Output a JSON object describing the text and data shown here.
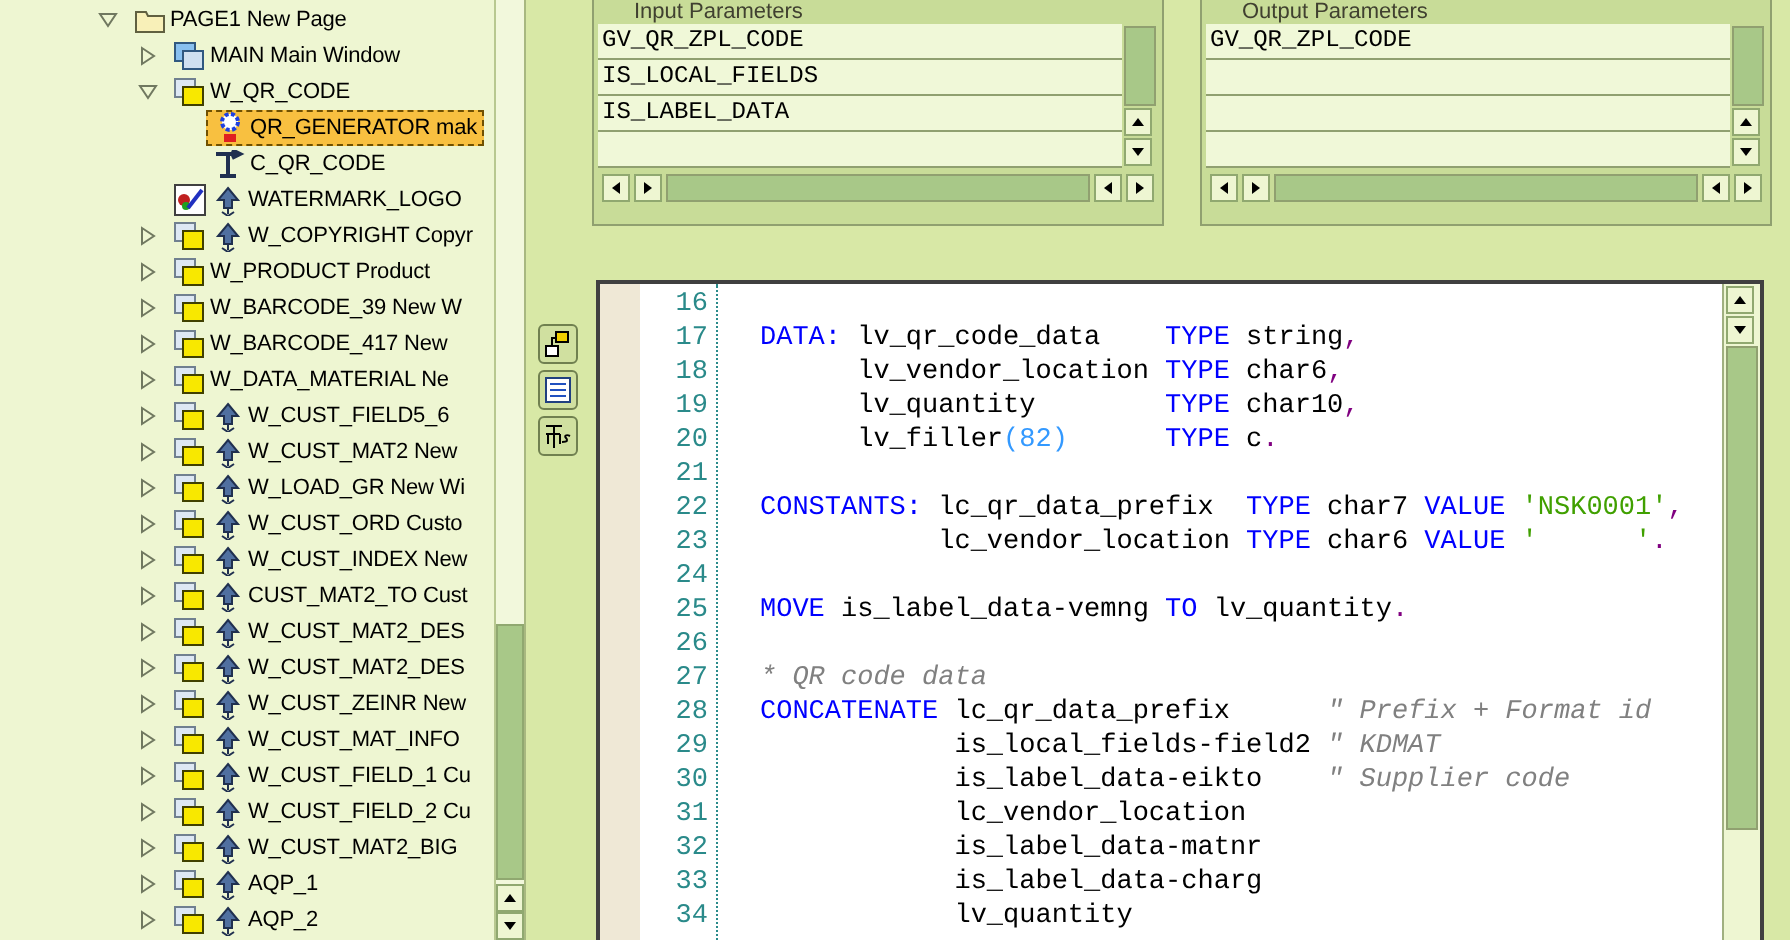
{
  "tree": {
    "items": [
      {
        "label": "PAGE1 New Page",
        "kind": "page",
        "flagged": false,
        "selected": false,
        "expanded": true,
        "children": [
          {
            "label": "MAIN Main Window",
            "kind": "main-window",
            "flagged": false,
            "selected": false,
            "expanded": false
          },
          {
            "label": "W_QR_CODE",
            "kind": "window",
            "flagged": false,
            "selected": false,
            "expanded": true,
            "children": [
              {
                "label": "QR_GENERATOR mak",
                "kind": "program",
                "flagged": false,
                "selected": true
              },
              {
                "label": "C_QR_CODE",
                "kind": "command",
                "flagged": false,
                "selected": false
              }
            ]
          },
          {
            "label": "WATERMARK_LOGO",
            "kind": "graphic",
            "flagged": true,
            "selected": false
          },
          {
            "label": "W_COPYRIGHT Copyr",
            "kind": "window",
            "flagged": true,
            "selected": false,
            "expanded": false
          },
          {
            "label": "W_PRODUCT Product",
            "kind": "window",
            "flagged": false,
            "selected": false,
            "expanded": false
          },
          {
            "label": "W_BARCODE_39 New W",
            "kind": "window",
            "flagged": false,
            "selected": false,
            "expanded": false
          },
          {
            "label": "W_BARCODE_417 New",
            "kind": "window",
            "flagged": false,
            "selected": false,
            "expanded": false
          },
          {
            "label": "W_DATA_MATERIAL Ne",
            "kind": "window",
            "flagged": false,
            "selected": false,
            "expanded": false
          },
          {
            "label": "W_CUST_FIELD5_6",
            "kind": "window",
            "flagged": true,
            "selected": false,
            "expanded": false
          },
          {
            "label": "W_CUST_MAT2 New",
            "kind": "window",
            "flagged": true,
            "selected": false,
            "expanded": false
          },
          {
            "label": "W_LOAD_GR New Wi",
            "kind": "window",
            "flagged": true,
            "selected": false,
            "expanded": false
          },
          {
            "label": "W_CUST_ORD Custo",
            "kind": "window",
            "flagged": true,
            "selected": false,
            "expanded": false
          },
          {
            "label": "W_CUST_INDEX New",
            "kind": "window",
            "flagged": true,
            "selected": false,
            "expanded": false
          },
          {
            "label": "CUST_MAT2_TO Cust",
            "kind": "window",
            "flagged": true,
            "selected": false,
            "expanded": false
          },
          {
            "label": "W_CUST_MAT2_DES",
            "kind": "window",
            "flagged": true,
            "selected": false,
            "expanded": false
          },
          {
            "label": "W_CUST_MAT2_DES",
            "kind": "window",
            "flagged": true,
            "selected": false,
            "expanded": false
          },
          {
            "label": "W_CUST_ZEINR New",
            "kind": "window",
            "flagged": true,
            "selected": false,
            "expanded": false
          },
          {
            "label": "W_CUST_MAT_INFO",
            "kind": "window",
            "flagged": true,
            "selected": false,
            "expanded": false
          },
          {
            "label": "W_CUST_FIELD_1 Cu",
            "kind": "window",
            "flagged": true,
            "selected": false,
            "expanded": false
          },
          {
            "label": "W_CUST_FIELD_2 Cu",
            "kind": "window",
            "flagged": true,
            "selected": false,
            "expanded": false
          },
          {
            "label": "W_CUST_MAT2_BIG",
            "kind": "window",
            "flagged": true,
            "selected": false,
            "expanded": false
          },
          {
            "label": "AQP_1",
            "kind": "window",
            "flagged": true,
            "selected": false,
            "expanded": false
          },
          {
            "label": "AQP_2",
            "kind": "window",
            "flagged": true,
            "selected": false,
            "expanded": false
          }
        ]
      }
    ]
  },
  "input_parameters": {
    "title": "Input Parameters",
    "rows": [
      "GV_QR_ZPL_CODE",
      "IS_LOCAL_FIELDS",
      "IS_LABEL_DATA"
    ]
  },
  "output_parameters": {
    "title": "Output Parameters",
    "rows": [
      "GV_QR_ZPL_CODE"
    ]
  },
  "editor": {
    "lines": [
      {
        "number": "16"
      },
      {
        "number": "17",
        "tokens": [
          {
            "kind": "keyword",
            "text": "DATA:"
          },
          {
            "kind": "ident",
            "text": " lv_qr_code_data    "
          },
          {
            "kind": "keyword",
            "text": "TYPE"
          },
          {
            "kind": "ident",
            "text": " string"
          },
          {
            "kind": "punct",
            "text": ","
          }
        ]
      },
      {
        "number": "18",
        "tokens": [
          {
            "kind": "ident",
            "text": "      lv_vendor_location "
          },
          {
            "kind": "keyword",
            "text": "TYPE"
          },
          {
            "kind": "ident",
            "text": " char6"
          },
          {
            "kind": "punct",
            "text": ","
          }
        ]
      },
      {
        "number": "19",
        "tokens": [
          {
            "kind": "ident",
            "text": "      lv_quantity        "
          },
          {
            "kind": "keyword",
            "text": "TYPE"
          },
          {
            "kind": "ident",
            "text": " char10"
          },
          {
            "kind": "punct",
            "text": ","
          }
        ]
      },
      {
        "number": "20",
        "tokens": [
          {
            "kind": "ident",
            "text": "      lv_filler"
          },
          {
            "kind": "number",
            "text": "(82)"
          },
          {
            "kind": "keyword",
            "text": "      TYPE"
          },
          {
            "kind": "ident",
            "text": " c"
          },
          {
            "kind": "punct",
            "text": "."
          }
        ]
      },
      {
        "number": "21"
      },
      {
        "number": "22",
        "tokens": [
          {
            "kind": "keyword",
            "text": "CONSTANTS:"
          },
          {
            "kind": "ident",
            "text": " lc_qr_data_prefix  "
          },
          {
            "kind": "keyword",
            "text": "TYPE"
          },
          {
            "kind": "ident",
            "text": " char7 "
          },
          {
            "kind": "keyword",
            "text": "VALUE"
          },
          {
            "kind": "string",
            "text": " 'NSK0001'"
          },
          {
            "kind": "punct",
            "text": ","
          }
        ]
      },
      {
        "number": "23",
        "tokens": [
          {
            "kind": "ident",
            "text": "           lc_vendor_location "
          },
          {
            "kind": "keyword",
            "text": "TYPE"
          },
          {
            "kind": "ident",
            "text": " char6 "
          },
          {
            "kind": "keyword",
            "text": "VALUE"
          },
          {
            "kind": "string",
            "text": " '      '"
          },
          {
            "kind": "punct",
            "text": "."
          }
        ]
      },
      {
        "number": "24"
      },
      {
        "number": "25",
        "tokens": [
          {
            "kind": "keyword",
            "text": "MOVE"
          },
          {
            "kind": "ident",
            "text": " is_label_data-vemng "
          },
          {
            "kind": "keyword",
            "text": "TO"
          },
          {
            "kind": "ident",
            "text": " lv_quantity"
          },
          {
            "kind": "punct",
            "text": "."
          }
        ]
      },
      {
        "number": "26"
      },
      {
        "number": "27",
        "tokens": [
          {
            "kind": "comment",
            "text": "* QR code data"
          }
        ]
      },
      {
        "number": "28",
        "tokens": [
          {
            "kind": "keyword",
            "text": "CONCATENATE"
          },
          {
            "kind": "ident",
            "text": " lc_qr_data_prefix      "
          },
          {
            "kind": "comment",
            "text": "\" Prefix + Format id"
          }
        ]
      },
      {
        "number": "29",
        "tokens": [
          {
            "kind": "ident",
            "text": "            is_local_fields-field2 "
          },
          {
            "kind": "comment",
            "text": "\" KDMAT"
          }
        ]
      },
      {
        "number": "30",
        "tokens": [
          {
            "kind": "ident",
            "text": "            is_label_data-eikto    "
          },
          {
            "kind": "comment",
            "text": "\" Supplier code"
          }
        ]
      },
      {
        "number": "31",
        "tokens": [
          {
            "kind": "ident",
            "text": "            lc_vendor_location"
          }
        ]
      },
      {
        "number": "32",
        "tokens": [
          {
            "kind": "ident",
            "text": "            is_label_data-matnr"
          }
        ]
      },
      {
        "number": "33",
        "tokens": [
          {
            "kind": "ident",
            "text": "            is_label_data-charg"
          }
        ]
      },
      {
        "number": "34",
        "tokens": [
          {
            "kind": "ident",
            "text": "            lv_quantity"
          }
        ]
      }
    ]
  }
}
